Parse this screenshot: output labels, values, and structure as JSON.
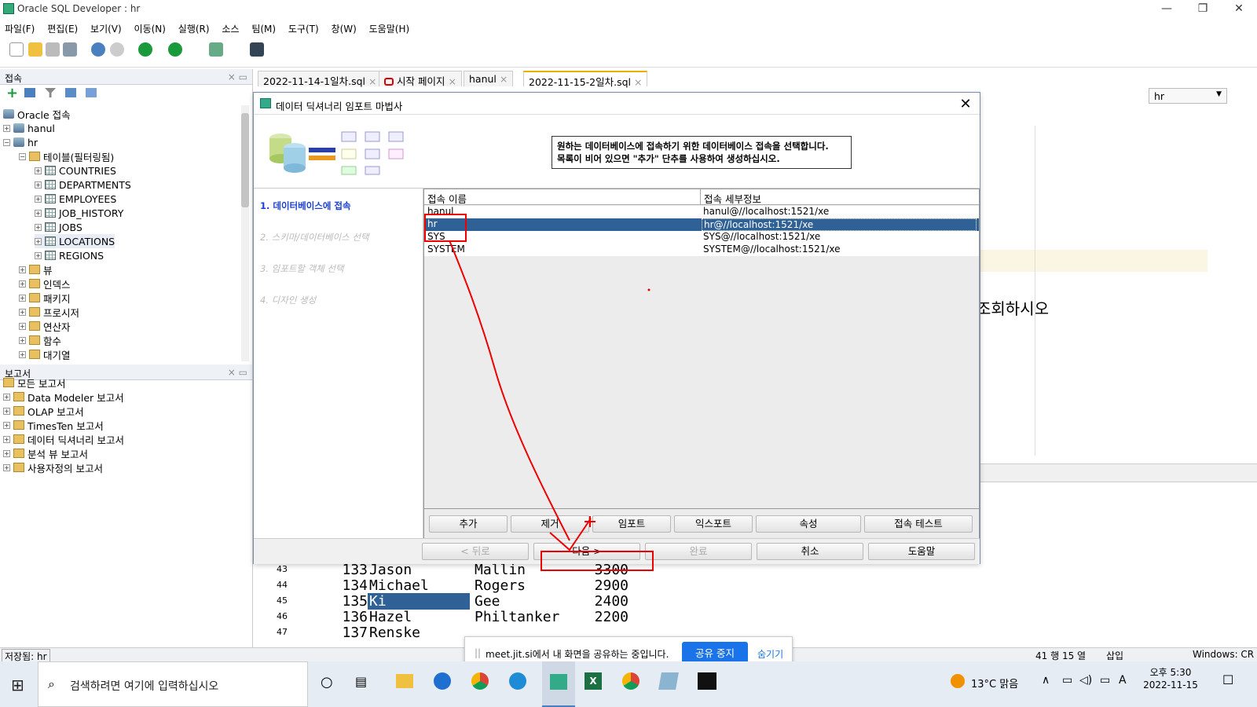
{
  "app": {
    "title": "Oracle SQL Developer : hr",
    "minimize": "—",
    "restore": "❐",
    "close": "✕"
  },
  "menu": [
    "파일(F)",
    "편집(E)",
    "보기(V)",
    "이동(N)",
    "실행(R)",
    "소스",
    "팀(M)",
    "도구(T)",
    "창(W)",
    "도움말(H)"
  ],
  "connections_panel": {
    "title": "접속",
    "root": "Oracle 접속",
    "items": [
      "hanul",
      "hr"
    ],
    "tables_folder": "테이블(필터링됨)",
    "tables": [
      "COUNTRIES",
      "DEPARTMENTS",
      "EMPLOYEES",
      "JOB_HISTORY",
      "JOBS",
      "LOCATIONS",
      "REGIONS"
    ],
    "folders": [
      "뷰",
      "인덱스",
      "패키지",
      "프로시저",
      "연산자",
      "함수",
      "대기열"
    ]
  },
  "reports_panel": {
    "title": "보고서",
    "root": "모든 보고서",
    "items": [
      "Data Modeler 보고서",
      "OLAP 보고서",
      "TimesTen 보고서",
      "데이터 딕셔너리 보고서",
      "분석 뷰 보고서",
      "사용자정의 보고서"
    ]
  },
  "tabs": [
    {
      "label": "2022-11-14-1일차.sql",
      "active": false
    },
    {
      "label": "시작 페이지",
      "active": false
    },
    {
      "label": "hanul",
      "active": false
    },
    {
      "label": "2022-11-15-2일차.sql",
      "active": true
    }
  ],
  "connection_selector": {
    "value": "hr"
  },
  "editor": {
    "partial_text": "조회하시오"
  },
  "result_grid": {
    "rows": [
      {
        "n": "43",
        "id": "133",
        "first": "Jason",
        "last": "Mallin",
        "salary": "3300"
      },
      {
        "n": "44",
        "id": "134",
        "first": "Michael",
        "last": "Rogers",
        "salary": "2900"
      },
      {
        "n": "45",
        "id": "135",
        "first": "Ki",
        "last": "Gee",
        "salary": "2400"
      },
      {
        "n": "46",
        "id": "136",
        "first": "Hazel",
        "last": "Philtanker",
        "salary": "2200"
      },
      {
        "n": "47",
        "id": "137",
        "first": "Renske",
        "last": "",
        "salary": ""
      }
    ]
  },
  "dialog": {
    "title": "데이터 딕셔너리 임포트 마법사",
    "hint_line1": "원하는 데이터베이스에 접속하기 위한 데이터베이스 접속을 선택합니다.",
    "hint_line2": "목록이 비어 있으면 \"추가\" 단추를 사용하여 생성하십시오.",
    "steps": [
      "1. 데이터베이스에 접속",
      "2. 스키마/데이터베이스 선택",
      "3. 임포트할 객체 선택",
      "4. 디자인 생성"
    ],
    "columns": [
      "접속 이름",
      "접속 세부정보"
    ],
    "connections": [
      {
        "name": "hanul",
        "detail": "hanul@//localhost:1521/xe",
        "selected": false
      },
      {
        "name": "hr",
        "detail": "hr@//localhost:1521/xe",
        "selected": true
      },
      {
        "name": "SYS",
        "detail": "SYS@//localhost:1521/xe",
        "selected": false
      },
      {
        "name": "SYSTEM",
        "detail": "SYSTEM@//localhost:1521/xe",
        "selected": false
      }
    ],
    "action_buttons": [
      "추가",
      "제거",
      "임포트",
      "익스포트",
      "속성",
      "접속 테스트"
    ],
    "nav": {
      "back": "< 뒤로",
      "next": "다음 >",
      "finish": "완료",
      "cancel": "취소",
      "help": "도움말"
    }
  },
  "statusbar": {
    "left": "저장됨: hr",
    "pos": "41 행 15 열",
    "mode": "삽입",
    "eol": "Windows: CR"
  },
  "share_bar": {
    "text": "meet.jit.si에서 내 화면을 공유하는 중입니다.",
    "stop": "공유 중지",
    "hide": "숨기기"
  },
  "taskbar": {
    "search": "검색하려면 여기에 입력하십시오",
    "weather": "13°C 맑음",
    "time": "오후 5:30",
    "date": "2022-11-15",
    "ime": "A"
  },
  "colors": {
    "selection": "#2f6196",
    "annotation": "#e00000",
    "tab_active_marker": "#e9b000",
    "share_button": "#1a73e8"
  }
}
